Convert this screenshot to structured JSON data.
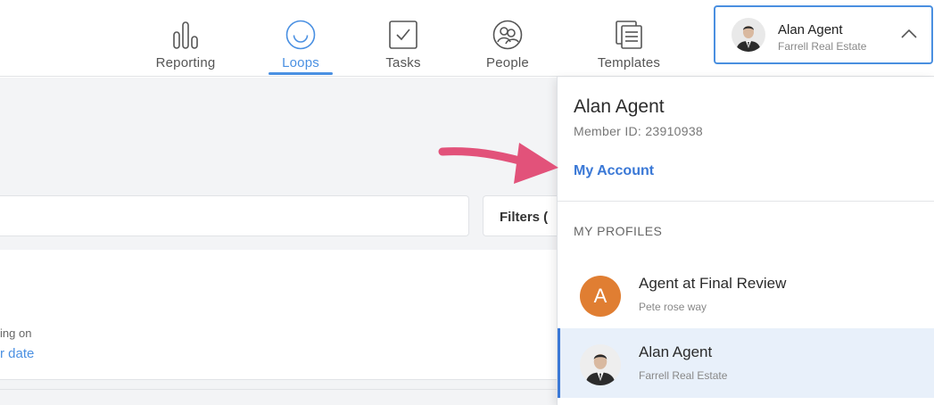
{
  "nav": {
    "items": [
      {
        "label": "Reporting",
        "icon": "bar-chart-icon"
      },
      {
        "label": "Loops",
        "icon": "loop-circle-icon",
        "active": true
      },
      {
        "label": "Tasks",
        "icon": "checkbox-icon"
      },
      {
        "label": "People",
        "icon": "people-icon"
      },
      {
        "label": "Templates",
        "icon": "templates-icon"
      }
    ],
    "accent_color": "#4a90e2"
  },
  "account": {
    "name": "Alan Agent",
    "org": "Farrell Real Estate"
  },
  "background": {
    "filters_label": "Filters (",
    "meta_text": "ing on",
    "link_text": "r date"
  },
  "dropdown": {
    "name": "Alan Agent",
    "member_id": "Member ID: 23910938",
    "my_account": "My Account",
    "profiles_heading": "MY PROFILES",
    "profiles": [
      {
        "initial": "A",
        "name": "Agent at Final Review",
        "sub": "Pete rose way",
        "avatar_color": "#e07e32"
      },
      {
        "name": "Alan Agent",
        "sub": "Farrell Real Estate",
        "selected": true
      }
    ]
  },
  "annotation": {
    "arrow_color": "#e2527a"
  }
}
